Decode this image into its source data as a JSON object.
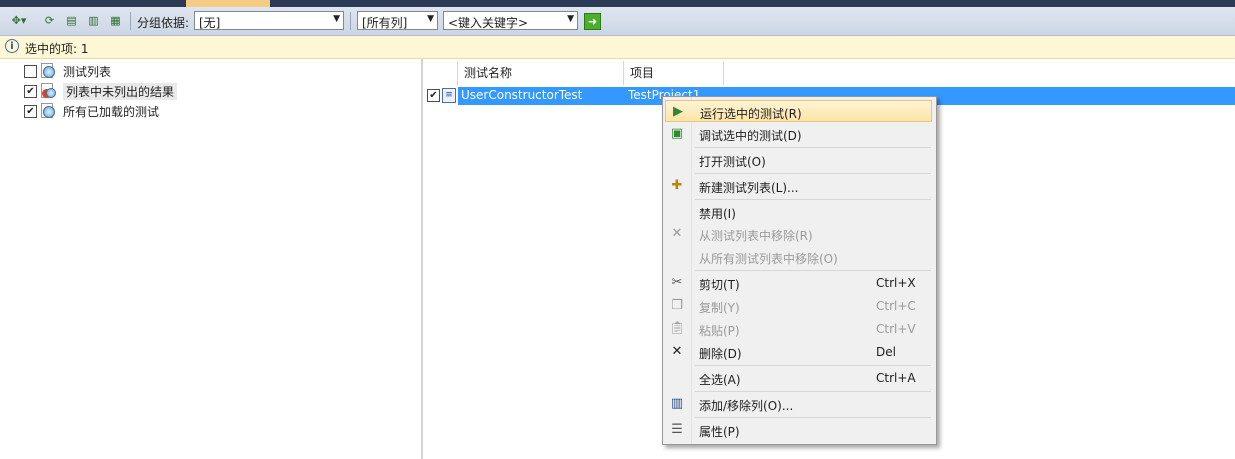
{
  "toolbar": {
    "group_label": "分组依据:",
    "group_value": "[无]",
    "columns_value": "[所有列]",
    "keyword_value": "<键入关键字>"
  },
  "infobar": {
    "text": "选中的项: 1"
  },
  "tree": {
    "items": [
      {
        "label": "测试列表",
        "checked": false
      },
      {
        "label": "列表中未列出的结果",
        "checked": true
      },
      {
        "label": "所有已加载的测试",
        "checked": true
      }
    ]
  },
  "grid": {
    "headers": [
      "测试名称",
      "项目"
    ],
    "row": {
      "name": "UserConstructorTest",
      "project": "TestProject1"
    }
  },
  "menu": {
    "items": [
      {
        "label": "运行选中的测试(R)",
        "shortcut": ""
      },
      {
        "label": "调试选中的测试(D)",
        "shortcut": ""
      },
      {
        "label": "打开测试(O)",
        "shortcut": ""
      },
      {
        "label": "新建测试列表(L)...",
        "shortcut": ""
      },
      {
        "label": "禁用(I)",
        "shortcut": ""
      },
      {
        "label": "从测试列表中移除(R)",
        "shortcut": ""
      },
      {
        "label": "从所有测试列表中移除(O)",
        "shortcut": ""
      },
      {
        "label": "剪切(T)",
        "shortcut": "Ctrl+X"
      },
      {
        "label": "复制(Y)",
        "shortcut": "Ctrl+C"
      },
      {
        "label": "粘贴(P)",
        "shortcut": "Ctrl+V"
      },
      {
        "label": "删除(D)",
        "shortcut": "Del"
      },
      {
        "label": "全选(A)",
        "shortcut": "Ctrl+A"
      },
      {
        "label": "添加/移除列(O)...",
        "shortcut": ""
      },
      {
        "label": "属性(P)",
        "shortcut": ""
      }
    ]
  },
  "colors": {
    "selection": "#3399ff",
    "menu_highlight": "#fde4a8",
    "infobar": "#fdf7d5"
  }
}
